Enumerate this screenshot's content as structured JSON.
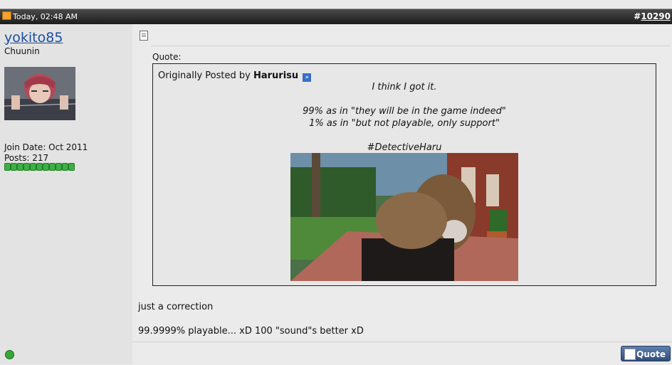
{
  "post": {
    "timestamp": "Today, 02:48 AM",
    "number_prefix": "#",
    "number": "10290"
  },
  "user": {
    "name": "yokito85",
    "title": "Chuunin",
    "join_date": "Join Date: Oct 2011",
    "posts": "Posts: 217",
    "reputation_dots": 11
  },
  "quote": {
    "label": "Quote:",
    "originally_posted_by": "Originally Posted by",
    "author": "Harurisu",
    "lines": [
      "I think I got it.",
      "99% as in \"they will be in the game indeed\"",
      "1% as in \"but not playable, only support\"",
      "#DetectiveHaru"
    ]
  },
  "message": {
    "line1": "just a correction",
    "line2": "99.9999% playable... xD 100 \"sound\"s better xD"
  },
  "buttons": {
    "quote": "Quote"
  }
}
